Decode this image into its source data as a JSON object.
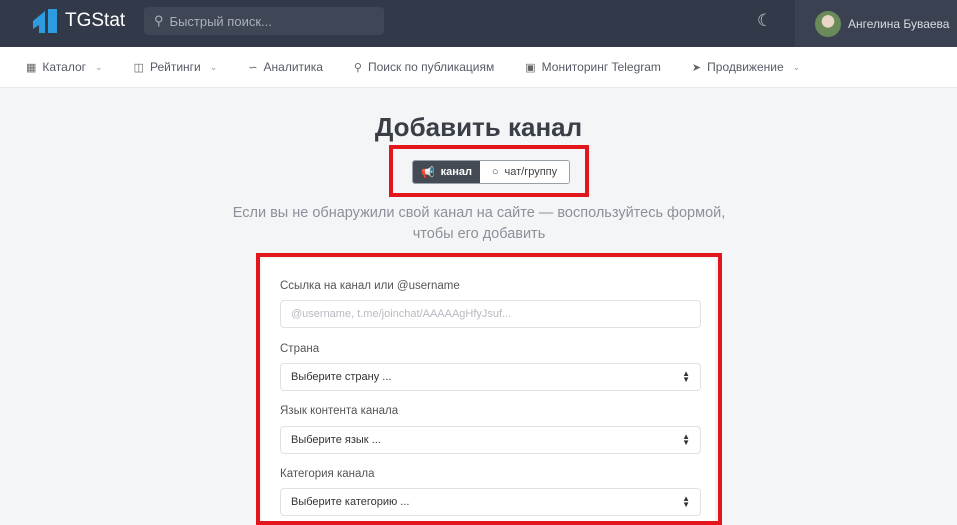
{
  "header": {
    "brand": "TGStat",
    "search_placeholder": "Быстрый поиск...",
    "user_name": "Ангелина Буваева"
  },
  "nav": [
    {
      "label": "Каталог",
      "icon": "grid-icon",
      "dropdown": true
    },
    {
      "label": "Рейтинги",
      "icon": "chart-box-icon",
      "dropdown": true
    },
    {
      "label": "Аналитика",
      "icon": "line-chart-icon",
      "dropdown": false
    },
    {
      "label": "Поиск по публикациям",
      "icon": "search-icon",
      "dropdown": false
    },
    {
      "label": "Мониторинг Telegram",
      "icon": "monitor-icon",
      "dropdown": false
    },
    {
      "label": "Продвижение",
      "icon": "rocket-icon",
      "dropdown": true
    }
  ],
  "page": {
    "title": "Добавить канал",
    "toggle": {
      "channel": "канал",
      "chat": "чат/группу"
    },
    "desc_line1": "Если вы не обнаружили свой канал на сайте — воспользуйтесь формой,",
    "desc_line2": "чтобы его добавить"
  },
  "form": {
    "link_label": "Ссылка на канал или @username",
    "link_placeholder": "@username, t.me/joinchat/AAAAAgHfyJsuf...",
    "country_label": "Страна",
    "country_value": "Выберите страну ...",
    "lang_label": "Язык контента канала",
    "lang_value": "Выберите язык ...",
    "cat_label": "Категория канала",
    "cat_value": "Выберите категорию ..."
  },
  "colors": {
    "header": "#323a49",
    "highlight": "#e3161e",
    "toggle_active": "#454b55"
  }
}
